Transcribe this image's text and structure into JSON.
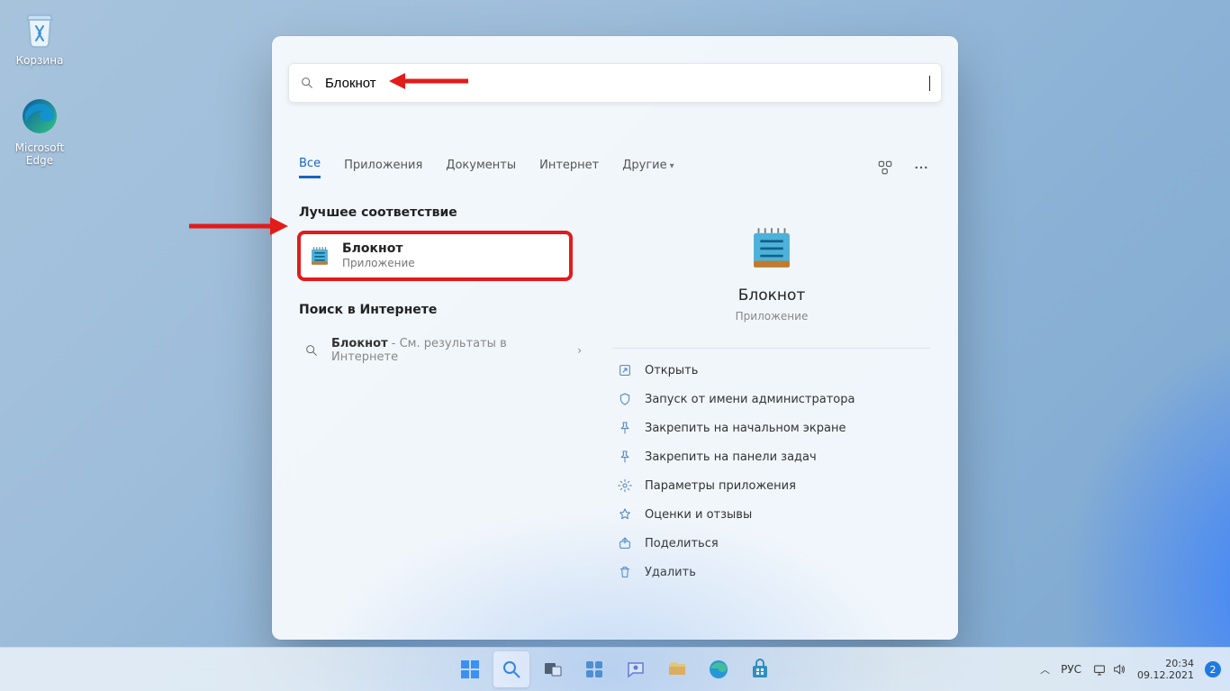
{
  "desktop_icons": {
    "recycle": "Корзина",
    "edge_l1": "Microsoft",
    "edge_l2": "Edge"
  },
  "search": {
    "value": "Блокнот"
  },
  "tabs": {
    "all": "Все",
    "apps": "Приложения",
    "docs": "Документы",
    "web": "Интернет",
    "more": "Другие"
  },
  "left": {
    "best_title": "Лучшее соответствие",
    "best_name": "Блокнот",
    "best_kind": "Приложение",
    "web_title": "Поиск в Интернете",
    "web_item_name": "Блокнот",
    "web_item_rest": " - См. результаты в Интернете"
  },
  "detail": {
    "title": "Блокнот",
    "kind": "Приложение",
    "actions": {
      "open": "Открыть",
      "admin": "Запуск от имени администратора",
      "pin_start": "Закрепить на начальном экране",
      "pin_task": "Закрепить на панели задач",
      "settings": "Параметры приложения",
      "reviews": "Оценки и отзывы",
      "share": "Поделиться",
      "delete": "Удалить"
    }
  },
  "taskbar": {
    "lang": "РУС",
    "time": "20:34",
    "date": "09.12.2021",
    "badge": "2"
  }
}
